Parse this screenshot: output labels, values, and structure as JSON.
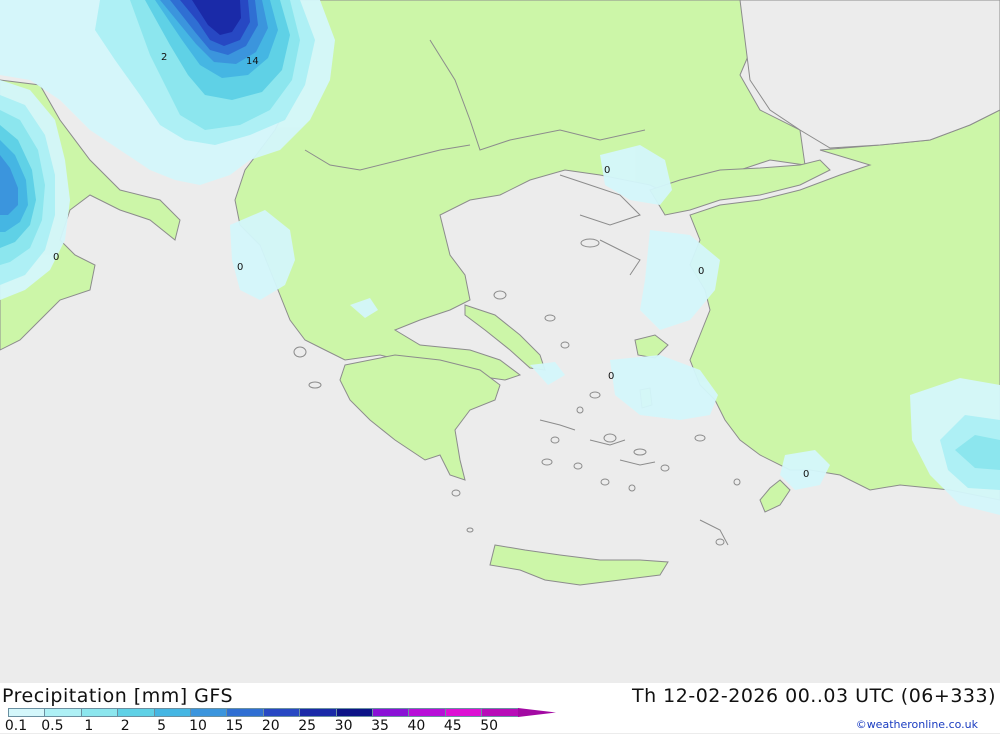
{
  "header": {
    "title_left": "Precipitation [mm] GFS",
    "title_right": "Th 12-02-2026 00..03 UTC (06+333)"
  },
  "legend": {
    "ticks": [
      "0.1",
      "0.5",
      "1",
      "2",
      "5",
      "10",
      "15",
      "20",
      "25",
      "30",
      "35",
      "40",
      "45",
      "50"
    ],
    "colors": [
      "#d4f7fb",
      "#aef0f5",
      "#8ce6ee",
      "#5fd1e6",
      "#45b6e3",
      "#3b95dd",
      "#2f6fd3",
      "#2748c3",
      "#1a2aa8",
      "#0c1488",
      "#8a12d6",
      "#b80fd8",
      "#dd10d4",
      "#b80cb8"
    ]
  },
  "map": {
    "contour_labels": [
      "2",
      "14",
      "0",
      "0",
      "0",
      "0",
      "0",
      "0"
    ],
    "colors": {
      "sea": "#ececec",
      "land": "#ccf6a8",
      "coast": "#8c8c8c"
    }
  },
  "footer": {
    "credit": "©weatheronline.co.uk"
  }
}
